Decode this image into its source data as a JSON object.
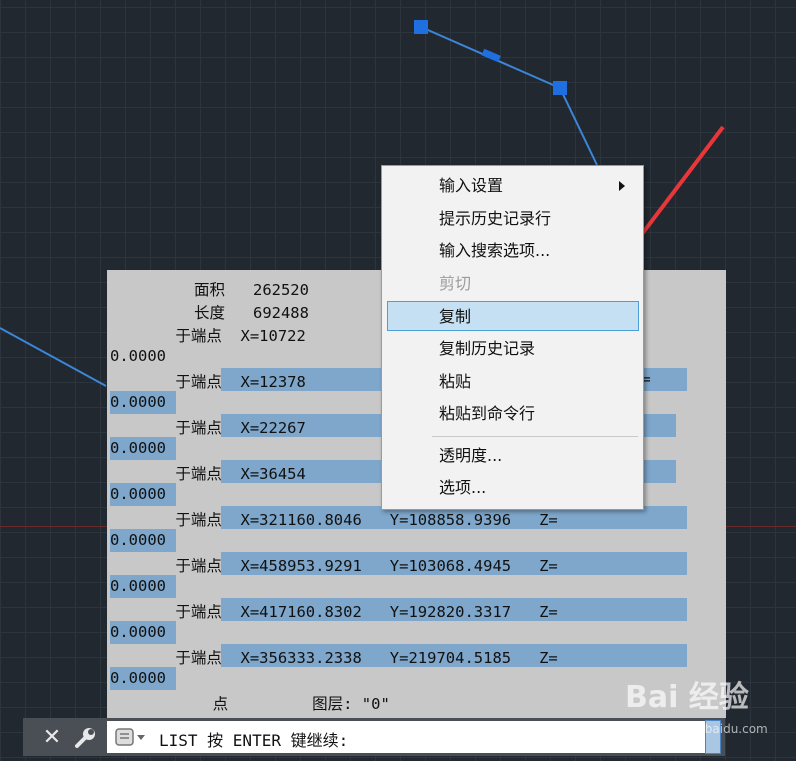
{
  "history": {
    "lines": [
      {
        "text": "         面积   262520",
        "highlight": false
      },
      {
        "text": "         长度   692488",
        "highlight": false
      },
      {
        "text": "       于端点  X=10722",
        "highlight": false
      },
      {
        "text": "0.0000",
        "highlight": false
      },
      {
        "text": "       于端点  X=12378",
        "highlight": true,
        "tail": "Z="
      },
      {
        "text": "0.0000",
        "highlight": true
      },
      {
        "text": "       于端点  X=22267",
        "highlight": true
      },
      {
        "text": "0.0000",
        "highlight": true
      },
      {
        "text": "       于端点  X=36454",
        "highlight": true
      },
      {
        "text": "0.0000",
        "highlight": true
      },
      {
        "text": "       于端点  X=321160.8046   Y=108858.9396   Z=",
        "highlight": true
      },
      {
        "text": "0.0000",
        "highlight": true
      },
      {
        "text": "       于端点  X=458953.9291   Y=103068.4945   Z=",
        "highlight": true
      },
      {
        "text": "0.0000",
        "highlight": true
      },
      {
        "text": "       于端点  X=417160.8302   Y=192820.3317   Z=",
        "highlight": true
      },
      {
        "text": "0.0000",
        "highlight": true
      },
      {
        "text": "       于端点  X=356333.2338   Y=219704.5185   Z=",
        "highlight": true
      },
      {
        "text": "0.0000",
        "highlight": true
      },
      {
        "text": "           点         图层: \"0\"",
        "highlight": false
      }
    ]
  },
  "context_menu": {
    "items": [
      {
        "label": "输入设置",
        "submenu": true
      },
      {
        "label": "提示历史记录行"
      },
      {
        "label": "输入搜索选项..."
      },
      {
        "label": "剪切",
        "disabled": true
      },
      {
        "label": "复制",
        "hover": true
      },
      {
        "label": "复制历史记录"
      },
      {
        "label": "粘贴"
      },
      {
        "label": "粘贴到命令行"
      },
      {
        "separator": true
      },
      {
        "label": "透明度..."
      },
      {
        "label": "选项..."
      }
    ]
  },
  "command_line": {
    "text": "LIST 按 ENTER 键继续:",
    "close_icon": "close-icon",
    "settings_icon": "wrench-icon",
    "recent_icon": "recent-commands-icon"
  },
  "watermark": {
    "text": "Bai 经验",
    "sub": "jingyan.baidu.com"
  },
  "colors": {
    "background": "#212830",
    "highlight": "#7ea7cb",
    "menu_hover": "#c4e0f2",
    "arrow": "#e8373a",
    "polyline": "#3b86d8"
  }
}
